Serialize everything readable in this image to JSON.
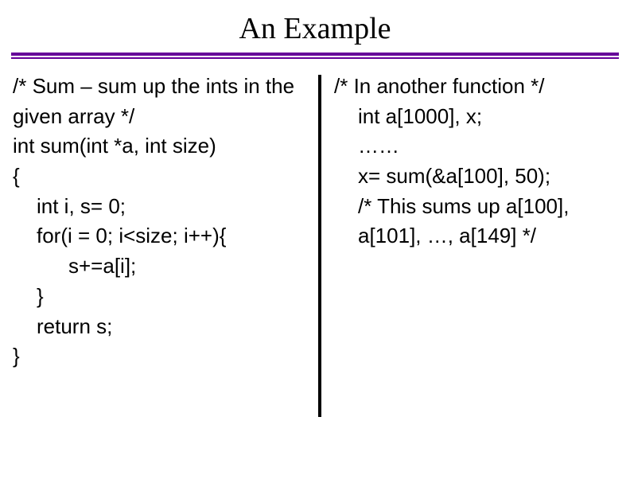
{
  "title": "An Example",
  "left": {
    "l1": "/* Sum – sum up the ints in the given array */",
    "l2": "int sum(int *a, int size)",
    "l3": "{",
    "l4": "int i, s= 0;",
    "l5": "for(i = 0; i<size; i++){",
    "l6": "s+=a[i];",
    "l7": "}",
    "l8": "return s;",
    "l9": "}"
  },
  "right": {
    "r1": "/* In another function */",
    "r2": "int a[1000], x;",
    "r3": "……",
    "r4": "x= sum(&a[100], 50);",
    "r5": "/* This sums up a[100], a[101], …, a[149] */"
  }
}
